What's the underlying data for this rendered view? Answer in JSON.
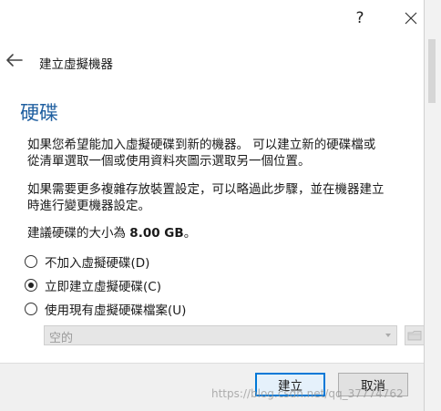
{
  "titlebar": {
    "help_label": "?"
  },
  "header": {
    "title": "建立虛擬機器"
  },
  "page": {
    "heading": "硬碟",
    "paragraph1_line1": "如果您希望能加入虛擬硬碟到新的機器。 可以建立新的硬碟檔或",
    "paragraph1_line2": "從清單選取一個或使用資料夾圖示選取另一個位置。",
    "paragraph2_line1": "如果需要更多複雜存放裝置設定，可以略過此步驟，並在機器建立",
    "paragraph2_line2": "時進行變更機器設定。",
    "recommend_prefix": "建議硬碟的大小為 ",
    "recommend_size": "8.00 GB",
    "recommend_suffix": "。"
  },
  "options": [
    {
      "label": "不加入虛擬硬碟(D)",
      "checked": false
    },
    {
      "label": "立即建立虛擬硬碟(C)",
      "checked": true
    },
    {
      "label": "使用現有虛擬硬碟檔案(U)",
      "checked": false
    }
  ],
  "existing_disk": {
    "value": "空的"
  },
  "buttons": {
    "create": "建立",
    "cancel": "取消"
  },
  "watermark": "https://blog.csdn.net/qq_37774762",
  "colors": {
    "heading": "#1f5fa0",
    "accent": "#0078d7",
    "footer": "#f0f0f0"
  },
  "icons": {
    "back": "arrow-left-icon",
    "close": "close-icon",
    "folder": "folder-icon",
    "dropdown": "chevron-down-icon"
  }
}
